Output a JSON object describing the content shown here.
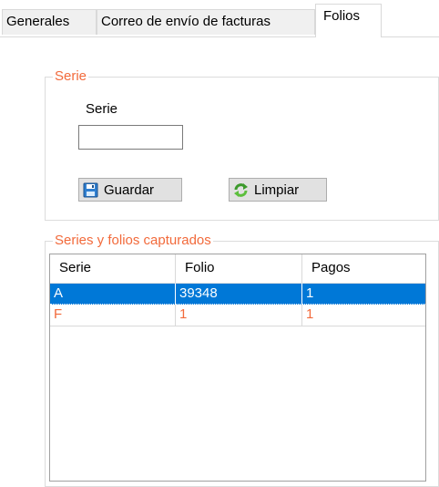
{
  "tabs": [
    {
      "label": "Generales"
    },
    {
      "label": "Correo de envío de facturas"
    },
    {
      "label": "Folios"
    }
  ],
  "serie_group": {
    "title": "Serie",
    "field_label": "Serie",
    "field_value": "",
    "save_label": "Guardar",
    "clear_label": "Limpiar"
  },
  "captured_group": {
    "title": "Series y folios capturados",
    "columns": [
      "Serie",
      "Folio",
      "Pagos"
    ],
    "rows": [
      {
        "serie": "A",
        "folio": "39348",
        "pagos": "1"
      },
      {
        "serie": "F",
        "folio": "1",
        "pagos": "1"
      }
    ]
  },
  "colors": {
    "accent": "#f26a3b",
    "selection": "#0078d7"
  },
  "icons": {
    "save": "floppy-disk-icon",
    "clear": "refresh-arrows-icon"
  }
}
